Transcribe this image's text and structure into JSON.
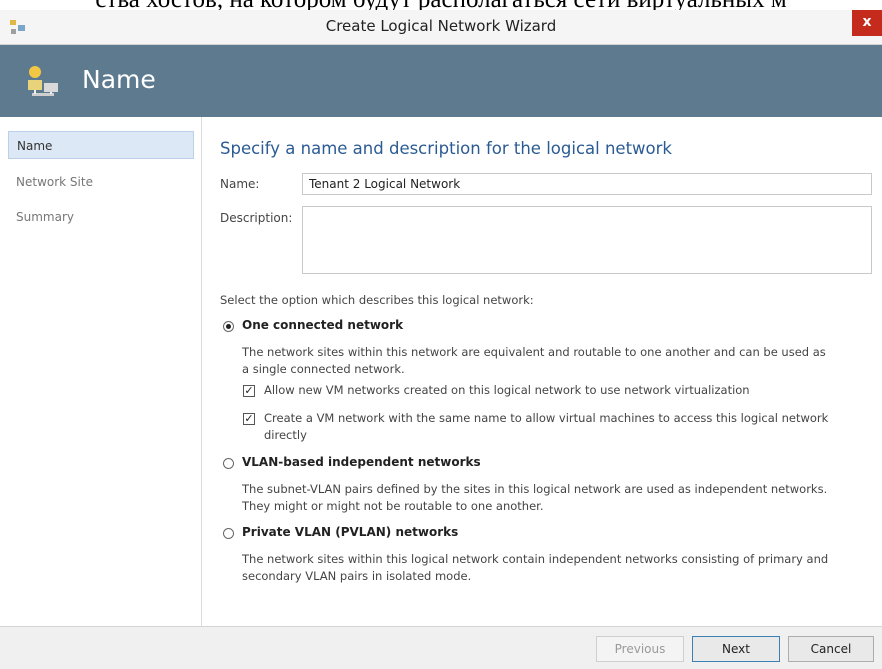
{
  "overlay_text": "ства хостов, на котором будут располагаться сети виртуальных м",
  "window": {
    "title": "Create Logical Network Wizard",
    "close_glyph": "x"
  },
  "header": {
    "title": "Name"
  },
  "sidebar": {
    "items": [
      {
        "label": "Name",
        "active": true
      },
      {
        "label": "Network Site",
        "active": false
      },
      {
        "label": "Summary",
        "active": false
      }
    ]
  },
  "main": {
    "heading": "Specify a name and description for the logical network",
    "name_label": "Name:",
    "name_value": "Tenant 2 Logical Network",
    "description_label": "Description:",
    "description_value": "",
    "option_prompt": "Select the option which describes this logical network:",
    "options": [
      {
        "label": "One connected network",
        "selected": true,
        "description_lines": [
          "The network sites within this network are equivalent and routable to one another and can be used as",
          "a single connected network."
        ],
        "checkboxes": [
          {
            "lines": [
              "Allow new VM networks created on this logical network to use network virtualization"
            ],
            "checked": true
          },
          {
            "lines": [
              "Create a VM network with the same name to allow virtual machines to access this logical network",
              "directly"
            ],
            "checked": true
          }
        ]
      },
      {
        "label": "VLAN-based independent networks",
        "selected": false,
        "description_lines": [
          "The subnet-VLAN pairs defined by the sites in this logical network are used as independent networks.",
          "They might or might not be routable to one another."
        ]
      },
      {
        "label": "Private VLAN (PVLAN) networks",
        "selected": false,
        "description_lines": [
          "The network sites within this logical network contain independent networks consisting of primary and",
          "secondary VLAN pairs in isolated mode."
        ]
      }
    ]
  },
  "footer": {
    "previous": "Previous",
    "next": "Next",
    "cancel": "Cancel"
  },
  "colors": {
    "header_bg": "#5e7a8f",
    "heading": "#2b5b93",
    "close_bg": "#c42b1c",
    "active_item": "#dde8f6"
  },
  "icons": {
    "app": "network-wizard-icon",
    "header": "logical-network-icon",
    "checkmark": "checkmark-icon"
  }
}
